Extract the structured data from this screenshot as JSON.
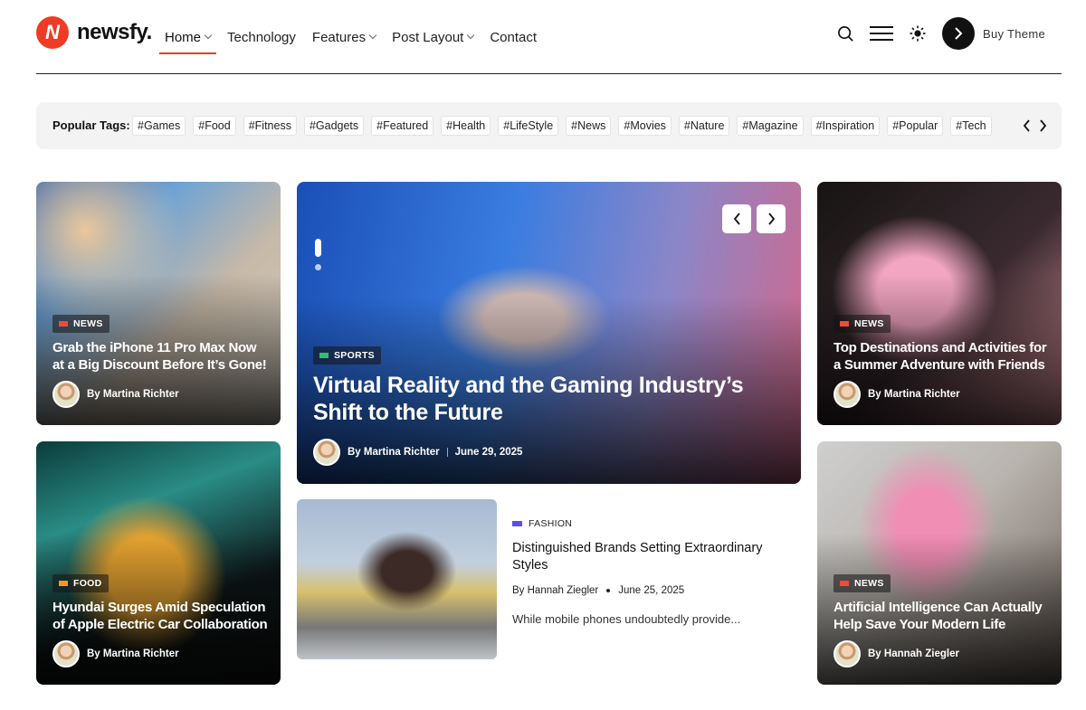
{
  "brand": {
    "logo_letter": "N",
    "name": "newsfy."
  },
  "nav": [
    {
      "label": "Home",
      "dropdown": true,
      "active": true
    },
    {
      "label": "Technology",
      "dropdown": false
    },
    {
      "label": "Features",
      "dropdown": true
    },
    {
      "label": "Post Layout",
      "dropdown": true
    },
    {
      "label": "Contact",
      "dropdown": false
    }
  ],
  "tools": {
    "search_icon": "search-icon",
    "menu_icon": "hamburger-icon",
    "theme_icon": "sun-icon",
    "buy_label": "Buy Theme"
  },
  "tags": {
    "label": "Popular Tags:",
    "items": [
      "Games",
      "Food",
      "Fitness",
      "Gadgets",
      "Featured",
      "Health",
      "LifeStyle",
      "News",
      "Movies",
      "Nature",
      "Magazine",
      "Inspiration",
      "Popular",
      "Tech"
    ]
  },
  "cards": {
    "phone": {
      "category": "NEWS",
      "category_color": "#ef4b3a",
      "title": "Grab the iPhone 11 Pro Max Now at a Big Discount Before It’s Gone!",
      "author": "By Martina Richter"
    },
    "featured": {
      "category": "SPORTS",
      "category_color": "#2fbf71",
      "title": "Virtual Reality and the Gaming Industry’s Shift to the Future",
      "author": "By Martina Richter",
      "date": "June 29, 2025"
    },
    "shoe": {
      "category": "NEWS",
      "category_color": "#ef4b3a",
      "title": "Top Destinations and Activities for a Summer Adventure with Friends",
      "author": "By Martina Richter"
    },
    "car": {
      "category": "FOOD",
      "category_color": "#f39a1e",
      "title": "Hyundai Surges Amid Speculation of Apple Electric Car Collaboration",
      "author": "By Martina Richter"
    },
    "fashion": {
      "category": "FASHION",
      "category_color": "#5b4ee6",
      "title": "Distinguished Brands Setting Extraordinary Styles",
      "author": "By Hannah Ziegler",
      "date": "June 25, 2025",
      "excerpt": "While mobile phones undoubtedly provide..."
    },
    "ai": {
      "category": "NEWS",
      "category_color": "#ef4b3a",
      "title": "Artificial Intelligence Can Actually Help Save Your Modern Life",
      "author": "By Hannah Ziegler"
    }
  }
}
